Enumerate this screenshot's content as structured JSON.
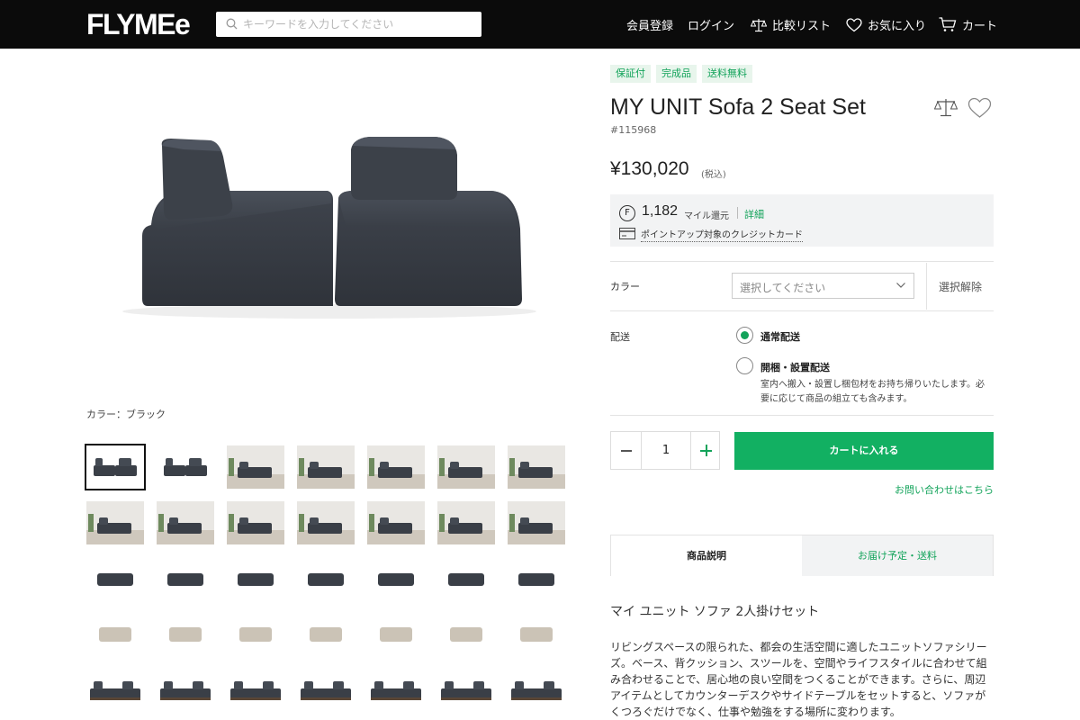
{
  "header": {
    "logo": "FLYMEe",
    "search_placeholder": "キーワードを入力してください",
    "nav": {
      "register": "会員登録",
      "login": "ログイン",
      "compare": "比較リスト",
      "favorites": "お気に入り",
      "cart": "カート"
    }
  },
  "gallery": {
    "color_label": "カラー：ブラック",
    "thumb_count": 35
  },
  "product": {
    "badges": [
      "保証付",
      "完成品",
      "送料無料"
    ],
    "title": "MY UNIT Sofa 2 Seat Set",
    "sku": "#115968",
    "price": "¥130,020",
    "tax_note": "(税込)",
    "miles": {
      "icon_letter": "F",
      "value": "1,182",
      "unit": "マイル還元",
      "detail_link": "詳細",
      "card_text": "ポイントアップ対象のクレジットカード"
    },
    "color": {
      "label": "カラー",
      "select_placeholder": "選択してください",
      "clear": "選択解除"
    },
    "delivery": {
      "label": "配送",
      "options": [
        {
          "label": "通常配送",
          "selected": true
        },
        {
          "label": "開梱・設置配送",
          "selected": false
        }
      ],
      "setup_desc": "室内へ搬入・設置し梱包材をお持ち帰りいたします。必要に応じて商品の組立ても含みます。"
    },
    "quantity": "1",
    "add_to_cart": "カートに入れる",
    "contact_link": "お問い合わせはこちら",
    "tabs": [
      "商品説明",
      "お届け予定・送料"
    ],
    "desc_title": "マイ ユニット ソファ 2人掛けセット",
    "desc_body": "リビングスペースの限られた、都会の生活空間に適したユニットソファシリーズ。ベース、背クッション、スツールを、空間やライフスタイルに合わせて組み合わせることで、居心地の良い空間をつくることができます。さらに、周辺アイテムとしてカウンターデスクやサイドテーブルをセットすると、ソファがくつろぐだけでなく、仕事や勉強をする場所に変わります。"
  },
  "colors": {
    "accent": "#12b062",
    "header_bg": "#0b0b0b",
    "sofa": "#3a3f47"
  }
}
